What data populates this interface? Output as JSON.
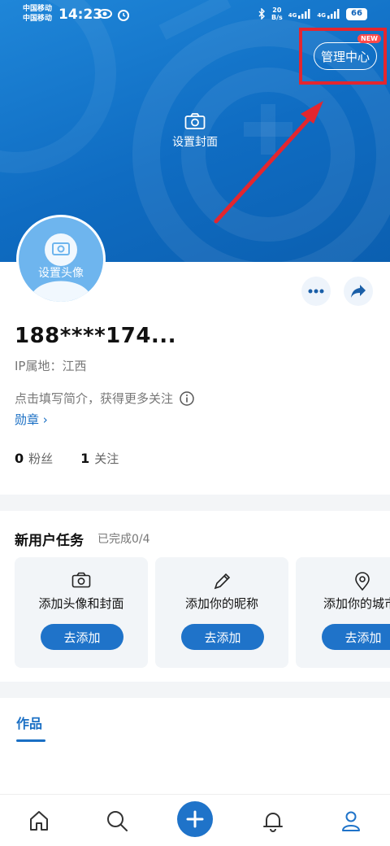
{
  "status_bar": {
    "carrier_1": "中国移动",
    "carrier_2": "中国移动",
    "time": "14:23",
    "net_speed_value": "20",
    "net_speed_unit": "B/s",
    "signal_1": "4G",
    "signal_2": "4G",
    "battery": "66"
  },
  "header": {
    "manage_button": "管理中心",
    "new_badge": "NEW",
    "set_cover": "设置封面"
  },
  "profile": {
    "avatar_label": "设置头像",
    "username": "188****174...",
    "ip_location": "IP属地：江西",
    "bio_prompt": "点击填写简介，获得更多关注",
    "badges_link": "勋章 ›",
    "followers_count": "0",
    "followers_label": "粉丝",
    "following_count": "1",
    "following_label": "关注"
  },
  "tasks": {
    "title": "新用户任务",
    "progress": "已完成0/4",
    "items": [
      {
        "label": "添加头像和封面",
        "button": "去添加",
        "icon": "camera-icon"
      },
      {
        "label": "添加你的昵称",
        "button": "去添加",
        "icon": "pencil-icon"
      },
      {
        "label": "添加你的城市",
        "button": "去添加",
        "icon": "location-pin-icon"
      }
    ]
  },
  "tabs": {
    "works": "作品"
  },
  "bottom_nav": {
    "items": [
      "home-icon",
      "search-icon",
      "plus-icon",
      "bell-icon",
      "profile-icon"
    ]
  },
  "colors": {
    "accent": "#1f73c9",
    "highlight": "#e3262f"
  }
}
